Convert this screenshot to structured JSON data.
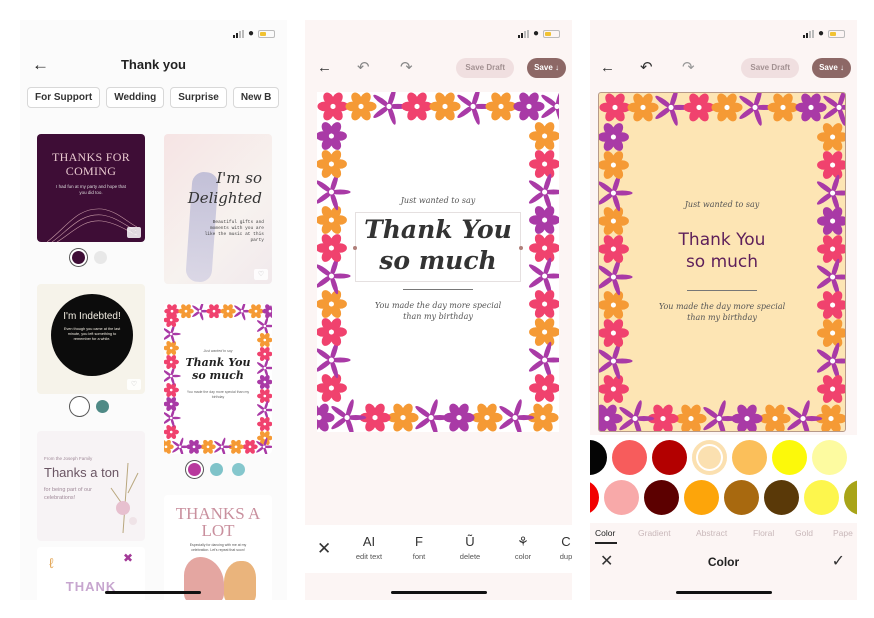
{
  "browse_screen": {
    "title": "Thank you",
    "back_icon": "arrow-left-icon",
    "categories": [
      "For Support",
      "Wedding",
      "Surprise",
      "New B"
    ],
    "cards": [
      {
        "title": "THANKS FOR COMING",
        "body": "I had fun at my party and hope that you did too.",
        "colors": [
          "#3e0d36",
          "#e8e8e8"
        ]
      },
      {
        "title": "I'm so Delighted",
        "body": "Beautiful gifts and moments with you are like the music at this party"
      },
      {
        "title": "I'm Indebted!",
        "body": "Even though you came at the last minute, you left something to remember for a while.",
        "colors": [
          "#ffffff",
          "#4f8a86"
        ]
      },
      {
        "title": "Thank You so much",
        "kicker": "Just wanted to say",
        "body": "You made the day more special than my birthday",
        "colors": [
          "#b8399d",
          "#7fc3c9",
          "#85c7cd"
        ]
      },
      {
        "title": "Thanks a ton",
        "kicker": "From the Joseph Family",
        "body": "for being part of our celebrations!"
      },
      {
        "title": "THANKS A LOT",
        "body": "Especially for dancing with me at my celebration. Let's repeat that soon!"
      },
      {
        "title": "THANK"
      }
    ]
  },
  "editor_screen": {
    "save_draft": "Save Draft",
    "save": "Save ↓",
    "card": {
      "kicker": "Just wanted to say",
      "headline_line1": "Thank You",
      "headline_line2": "so much",
      "subtext_line1": "You made the day more special",
      "subtext_line2": "than my birthday"
    },
    "tools": [
      {
        "label": "edit text",
        "icon": "AI"
      },
      {
        "label": "font",
        "icon": "F"
      },
      {
        "label": "delete",
        "icon": "Ũ"
      },
      {
        "label": "color",
        "icon": "⚘"
      },
      {
        "label": "dup",
        "icon": "C"
      }
    ]
  },
  "color_screen": {
    "save_draft": "Save Draft",
    "save": "Save ↓",
    "card_background": "#fde5b4",
    "card": {
      "kicker": "Just wanted to say",
      "headline_line1": "Thank You",
      "headline_line2": "so much",
      "subtext_line1": "You made the day more special",
      "subtext_line2": "than my birthday"
    },
    "palette_row1": [
      "#050505",
      "#f75c5c",
      "#b30000",
      "#fbe0b0",
      "#fbbf5a",
      "#fcf90a",
      "#fdfba0"
    ],
    "palette_row2": [
      "#f20000",
      "#f8a9a9",
      "#5c0000",
      "#fda50a",
      "#a8690f",
      "#5a3908",
      "#fdf64d",
      "#a8a418"
    ],
    "selected_color": "#fbe0b0",
    "tabs": [
      "Color",
      "Gradient",
      "Abstract",
      "Floral",
      "Gold",
      "Pape"
    ],
    "active_tab": "Color",
    "bottom_title": "Color"
  }
}
